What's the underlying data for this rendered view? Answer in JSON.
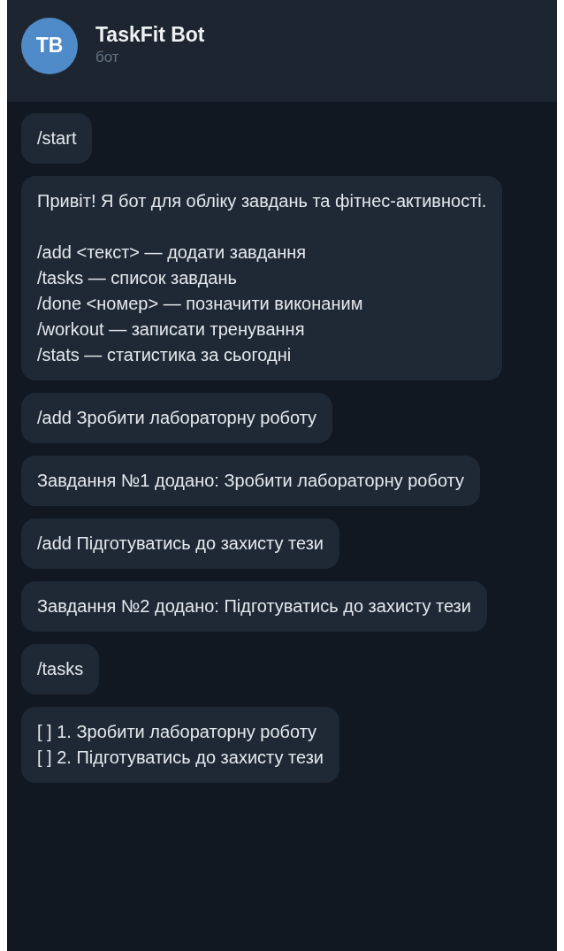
{
  "header": {
    "avatar_initials": "TB",
    "title": "TaskFit Bot",
    "subtitle": "бот"
  },
  "messages": [
    {
      "text": "/start"
    },
    {
      "text": "Привіт! Я бот для обліку завдань та фітнес-активності.\n\n/add <текст> — додати завдання\n/tasks — список завдань\n/done <номер> — позначити виконаним\n/workout — записати тренування\n/stats — статистика за сьогодні"
    },
    {
      "text": "/add Зробити лабораторну роботу"
    },
    {
      "text": "Завдання №1 додано: Зробити лабораторну роботу"
    },
    {
      "text": "/add Підготуватись до захисту тези"
    },
    {
      "text": "Завдання №2 додано: Підготуватись до захисту тези"
    },
    {
      "text": "/tasks"
    },
    {
      "text": "[ ] 1. Зробити лабораторну роботу\n[ ] 2. Підготуватись до захисту тези"
    }
  ]
}
